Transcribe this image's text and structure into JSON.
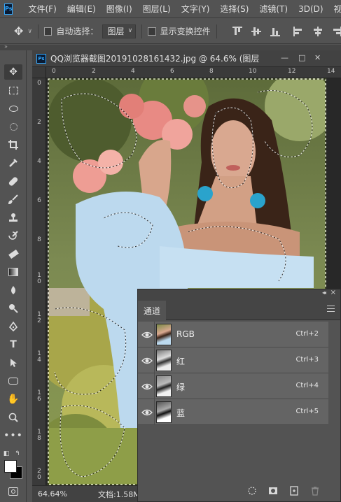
{
  "app": {
    "logo_text": "Ps"
  },
  "menu": [
    "文件(F)",
    "编辑(E)",
    "图像(I)",
    "图层(L)",
    "文字(Y)",
    "选择(S)",
    "滤镜(T)",
    "3D(D)",
    "视图"
  ],
  "options": {
    "auto_select_label": "自动选择：",
    "auto_select_value": "图层",
    "show_transform_label": "显示变换控件"
  },
  "document": {
    "title": "QQ浏览器截图20191028161432.jpg @ 64.6% (图层",
    "minimize": "—",
    "maximize": "□",
    "close": "✕",
    "zoom": "64.64%",
    "doc_info": "文档:1.58M"
  },
  "ruler": {
    "h_labels": [
      "0",
      "2",
      "4",
      "6",
      "8",
      "10",
      "12",
      "14"
    ],
    "v_labels": [
      "0",
      "2",
      "4",
      "6",
      "8",
      "1\n0",
      "1\n2",
      "1\n4",
      "1\n6",
      "1\n8",
      "2\n0"
    ]
  },
  "panel": {
    "tab_label": "通道",
    "channels": [
      {
        "name": "RGB",
        "shortcut": "Ctrl+2",
        "thumb": "color"
      },
      {
        "name": "红",
        "shortcut": "Ctrl+3",
        "thumb": "gray"
      },
      {
        "name": "绿",
        "shortcut": "Ctrl+4",
        "thumb": "gray"
      },
      {
        "name": "蓝",
        "shortcut": "Ctrl+5",
        "thumb": "gray"
      }
    ]
  }
}
